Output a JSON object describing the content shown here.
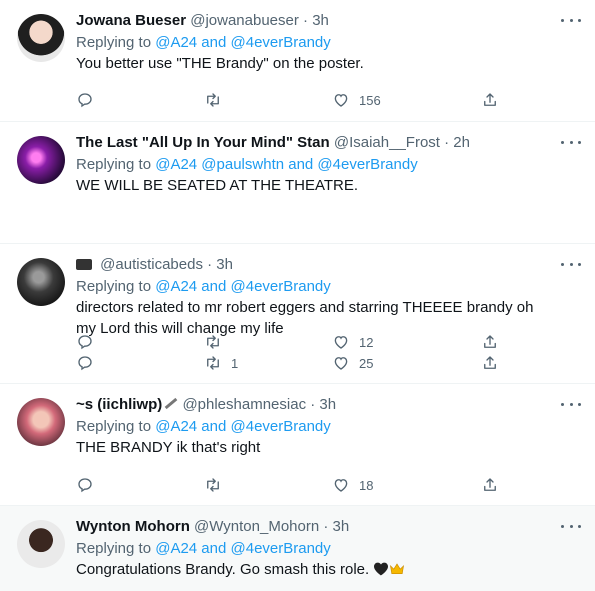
{
  "tweets": [
    {
      "name": "Jowana Bueser",
      "handle": "@jowanabueser",
      "time": "· 3h",
      "replying_prefix": "Replying to ",
      "replying_to": "@A24 and @4everBrandy",
      "body": "You better use \"THE Brandy\" on the poster.",
      "replies": "",
      "retweets": "",
      "likes": "156"
    },
    {
      "name": "The Last \"All Up In Your Mind\" Stan",
      "handle": "@Isaiah__Frost",
      "time": "· 2h",
      "replying_prefix": "Replying to ",
      "replying_to": "@A24 @paulswhtn and @4everBrandy",
      "body": "WE WILL BE SEATED AT THE THEATRE.",
      "replies": "",
      "retweets": "",
      "likes": "12"
    },
    {
      "name": "",
      "handle": "@autisticabeds",
      "time": "· 3h",
      "replying_prefix": "Replying to ",
      "replying_to": "@A24 and @4everBrandy",
      "body": "directors related to mr robert eggers and starring THEEEE brandy oh my Lord this will change my life",
      "replies": "",
      "retweets": "1",
      "likes": "25"
    },
    {
      "name": "~s (iichliwp)",
      "handle": "@phleshamnesiac",
      "time": "· 3h",
      "replying_prefix": "Replying to ",
      "replying_to": "@A24 and @4everBrandy",
      "body": "THE BRANDY ik that's right",
      "replies": "",
      "retweets": "",
      "likes": "18"
    },
    {
      "name": "Wynton Mohorn",
      "handle": "@Wynton_Mohorn",
      "time": "· 3h",
      "replying_prefix": "Replying to ",
      "replying_to": "@A24 and @4everBrandy",
      "body": "Congratulations Brandy. Go smash this role."
    }
  ],
  "colors": {
    "link": "#1d9bf0",
    "muted": "#536471",
    "text": "#0f1419",
    "highlight_bg": "#f7f9f9"
  },
  "icons": [
    "reply-icon",
    "retweet-icon",
    "like-icon",
    "share-icon",
    "more-icon",
    "black-heart-emoji",
    "crown-emoji",
    "movie-camera-emoji",
    "knife-emoji"
  ]
}
